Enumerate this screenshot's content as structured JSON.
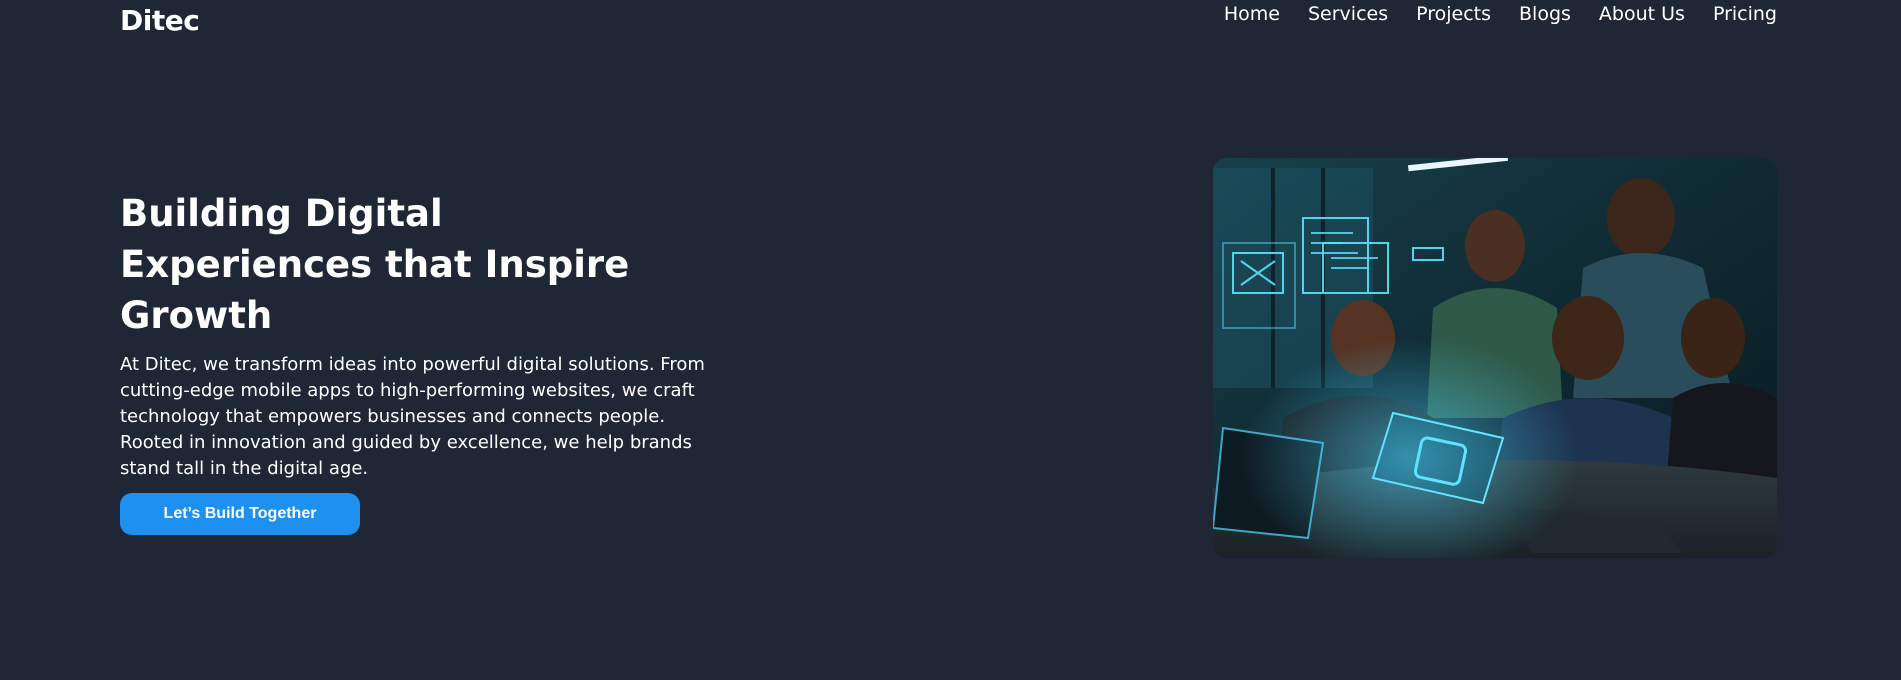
{
  "brand": {
    "name": "Ditec"
  },
  "nav": {
    "items": [
      "Home",
      "Services",
      "Projects",
      "Blogs",
      "About Us",
      "Pricing"
    ]
  },
  "hero": {
    "title_lines": [
      "Building Digital",
      "Experiences that Inspire",
      "Growth"
    ],
    "description": "At Ditec, we transform ideas into powerful digital solutions. From cutting-edge mobile apps to high-performing websites, we craft technology that empowers businesses and connects people. Rooted in innovation and guided by excellence, we help brands stand tall in the digital age.",
    "cta_label": "Let’s Build Together"
  },
  "colors": {
    "background": "#1f2635",
    "accent": "#1e90f0",
    "text": "#ffffff"
  },
  "icons": {
    "hero_image": "team-collaborating-on-laptops-photo"
  }
}
